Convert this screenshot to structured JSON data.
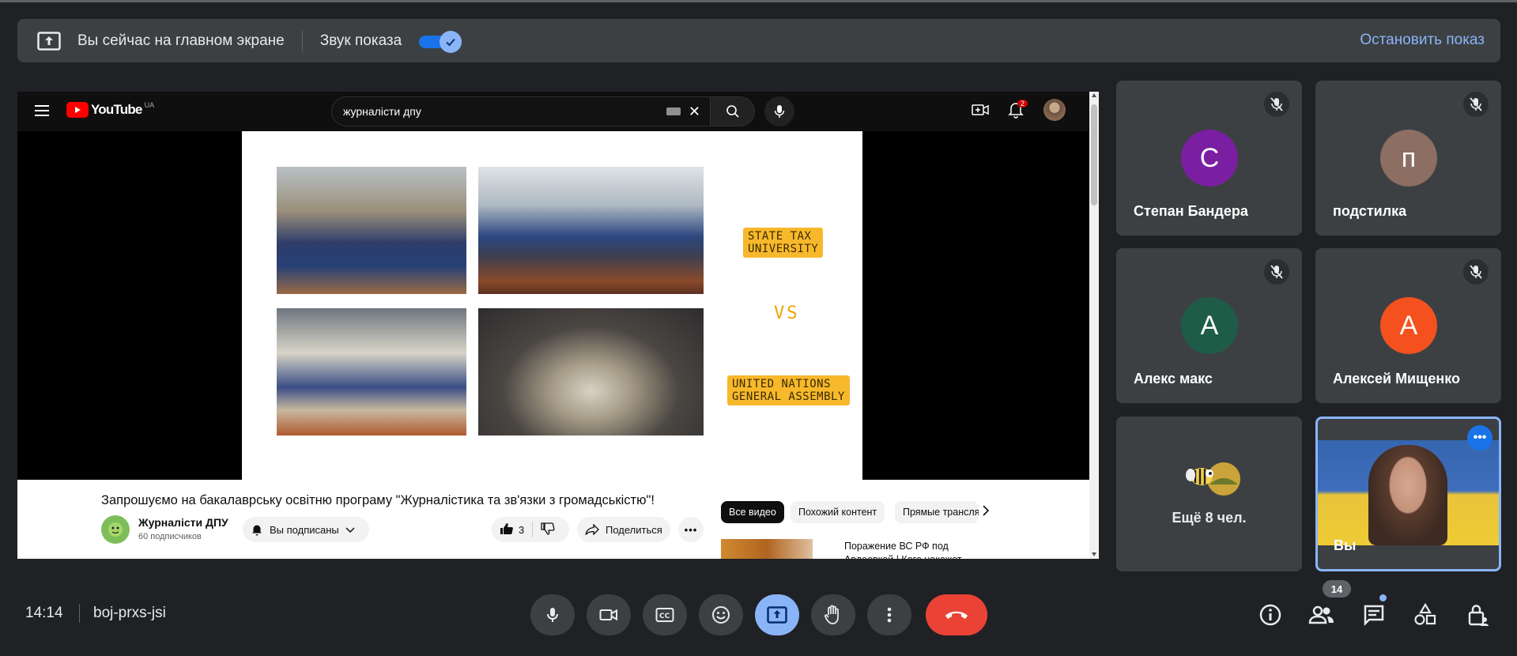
{
  "banner": {
    "presenting_text": "Вы сейчас на главном экране",
    "audio_label": "Звук показа",
    "audio_on": true,
    "stop_label": "Остановить показ"
  },
  "youtube": {
    "logo_text": "YouTube",
    "country": "UA",
    "search_value": "журналісти дпу",
    "notification_count": "2",
    "slide": {
      "tag_top": "STATE TAX\nUNIVERSITY",
      "vs": "VS",
      "tag_bottom": "UNITED NATIONS\nGENERAL ASSEMBLY"
    },
    "video_title": "Запрошуємо на бакалаврську освітню програму \"Журналістика та зв'язки з громадськістю\"!",
    "channel_name": "Журналісти ДПУ",
    "subscribers": "60 подписчиков",
    "subscribed_label": "Вы подписаны",
    "likes": "3",
    "share_label": "Поделиться",
    "chips": [
      "Все видео",
      "Похожий контент",
      "Прямые трансляции"
    ],
    "rec_title": "Поражение ВС РФ под Авдеевкой | Кого накажет..."
  },
  "participants": [
    {
      "initial": "С",
      "name": "Степан Бандера",
      "color": "#7b1fa2"
    },
    {
      "initial": "п",
      "name": "подстилка",
      "color": "#8d6e63"
    },
    {
      "initial": "А",
      "name": "Алекс макс",
      "color": "#1e5c48"
    },
    {
      "initial": "А",
      "name": "Алексей Мищенко",
      "color": "#f4511e"
    }
  ],
  "more_people": "Ещё 8 чел.",
  "self_name": "Вы",
  "bottom": {
    "time": "14:14",
    "meeting_code": "boj-prxs-jsi",
    "participant_count": "14"
  },
  "colors": {
    "accent": "#8ab4f8",
    "leave": "#ea4335",
    "surface": "#3c4043",
    "background": "#202124"
  }
}
